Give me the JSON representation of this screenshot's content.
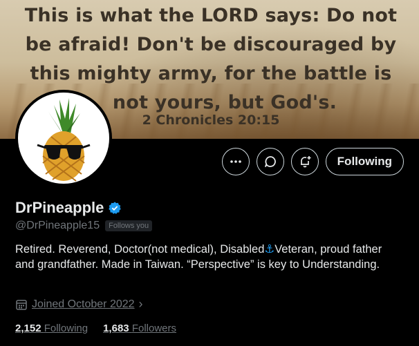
{
  "banner": {
    "verse_lines": [
      "This is what the LORD says: Do not",
      "be afraid! Don't be discouraged by",
      "this mighty army, for the battle is",
      "not yours, but God's."
    ],
    "reference": "2 Chronicles 20:15"
  },
  "avatar": {
    "icon": "pineapple-with-sunglasses"
  },
  "actions": {
    "more_icon": "more-dots-icon",
    "message_icon": "message-icon",
    "notify_icon": "bell-plus-icon",
    "follow_label": "Following"
  },
  "profile": {
    "display_name": "DrPineapple",
    "handle": "@DrPineapple15",
    "follows_you": "Follows you",
    "bio": "Retired. Reverend, Doctor(not medical), Disabled⚓Veteran, proud father and grandfather. Made in Taiwan. “Perspective” is key to Understanding.",
    "joined": "Joined October 2022"
  },
  "stats": {
    "following_count": "2,152",
    "following_label": "Following",
    "followers_count": "1,683",
    "followers_label": "Followers"
  },
  "colors": {
    "background": "#000000",
    "text": "#e7e9ea",
    "muted": "#71767b",
    "verified": "#1d9bf0",
    "anchor": "#1d9bf0"
  }
}
